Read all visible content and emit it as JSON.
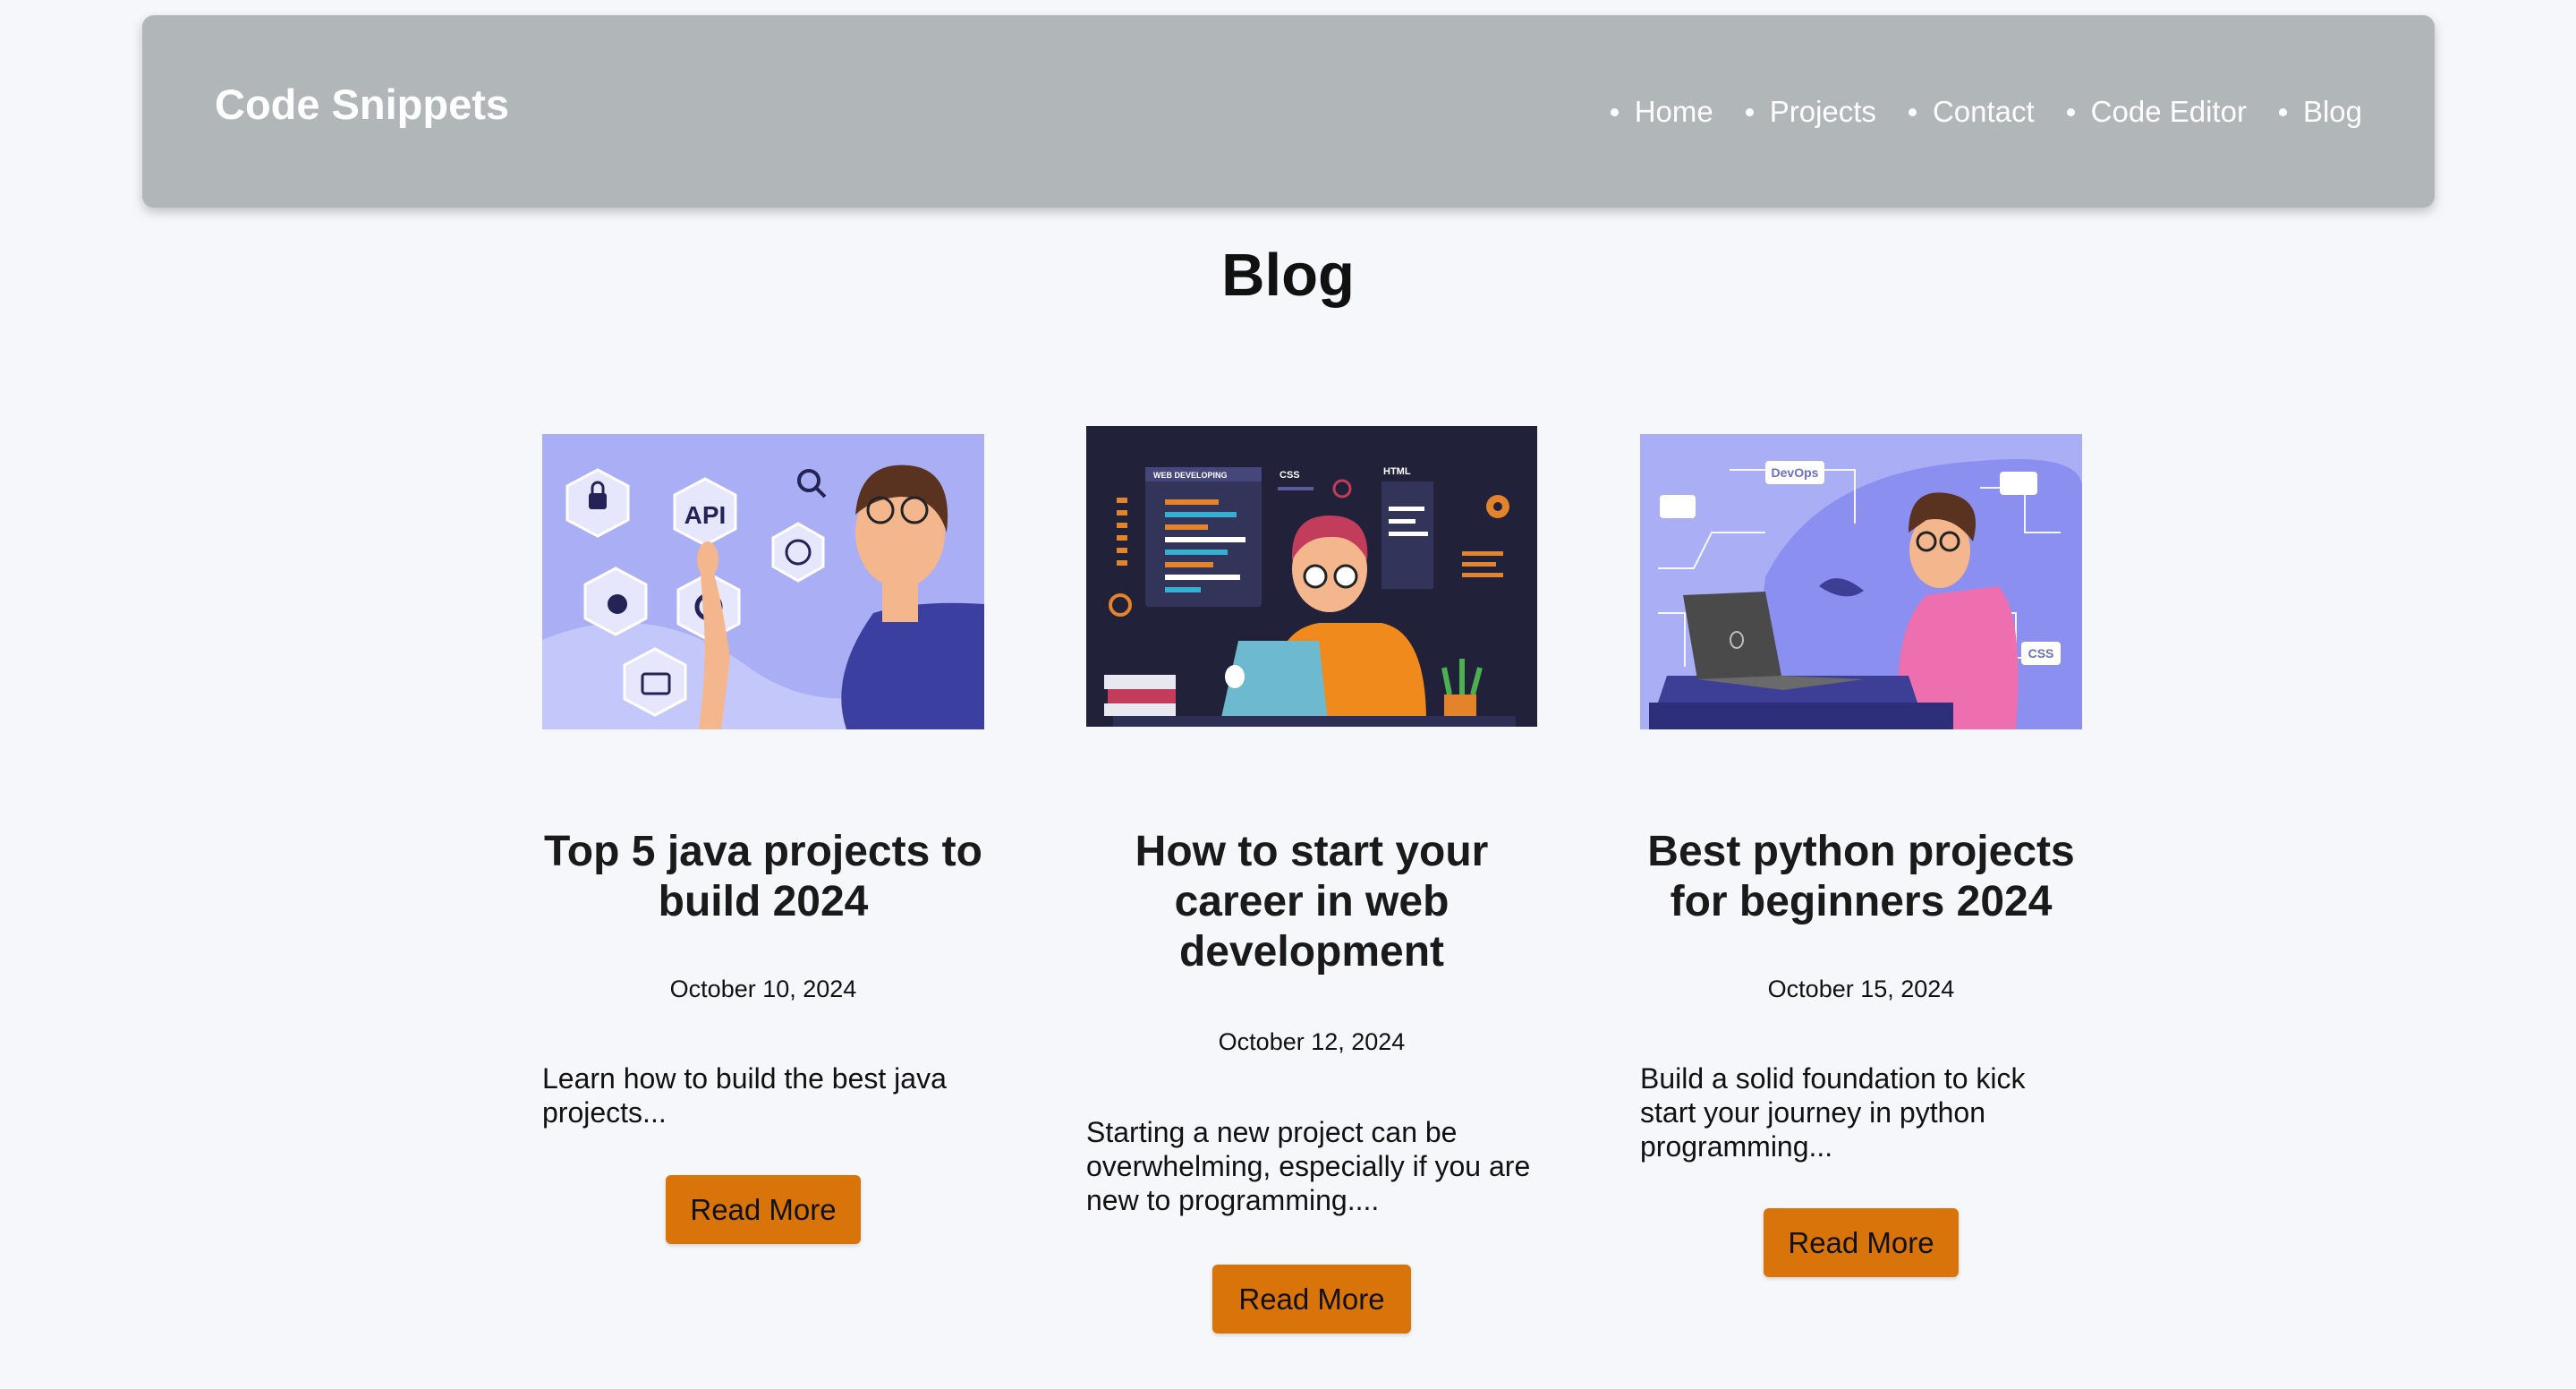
{
  "header": {
    "logo": "Code Snippets",
    "nav": [
      "Home",
      "Projects",
      "Contact",
      "Code Editor",
      "Blog"
    ]
  },
  "page_title": "Blog",
  "posts": [
    {
      "title": "Top 5 java projects to build 2024",
      "date": "October 10, 2024",
      "excerpt": "Learn how to build the best java projects...",
      "button": "Read More",
      "image": {
        "icon_texts": [
          "API"
        ]
      }
    },
    {
      "title": "How to start your career in web development",
      "date": "October 12, 2024",
      "excerpt": "Starting a new project can be overwhelming, especially if you are new to programming....",
      "button": "Read More",
      "image": {
        "icon_texts": [
          "WEB DEVELOPING",
          "CSS",
          "HTML"
        ]
      }
    },
    {
      "title": "Best python projects for beginners 2024",
      "date": "October 15, 2024",
      "excerpt": "Build a solid foundation to kick start your journey in python programming...",
      "button": "Read More",
      "image": {
        "icon_texts": [
          "DevOps",
          "CSS"
        ]
      }
    }
  ],
  "colors": {
    "header_bg": "#b1b6b9",
    "page_bg": "#f5f7fa",
    "button_bg": "#d8740a",
    "image_lavender": "#a9aef5",
    "image_dark": "#21213a"
  }
}
